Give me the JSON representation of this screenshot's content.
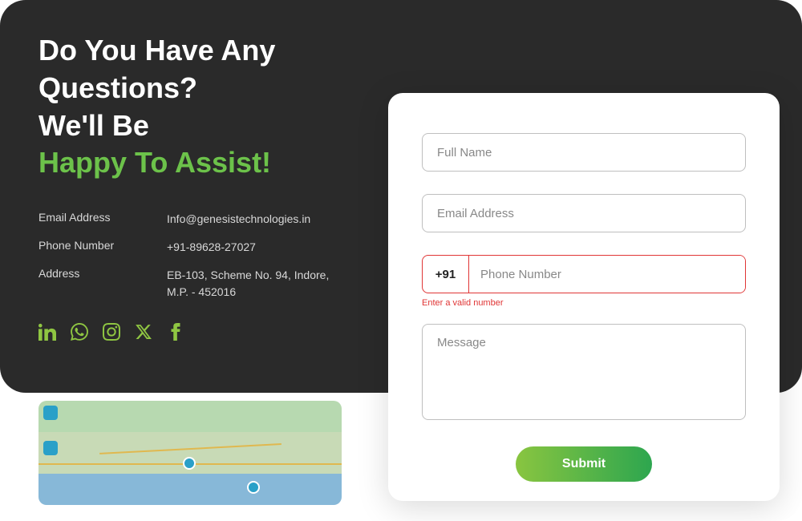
{
  "heading": {
    "line1": "Do You Have Any Questions?",
    "line2": "We'll Be",
    "line3": "Happy To Assist!"
  },
  "contact": {
    "email_label": "Email Address",
    "email_value": "Info@genesistechnologies.in",
    "phone_label": "Phone Number",
    "phone_value": "+91-89628-27027",
    "address_label": "Address",
    "address_value": "EB-103, Scheme No. 94, Indore, M.P. - 452016"
  },
  "form": {
    "fullname_placeholder": "Full Name",
    "email_placeholder": "Email Address",
    "phone_prefix": "+91",
    "phone_placeholder": "Phone Number",
    "phone_error": "Enter a valid number",
    "message_placeholder": "Message",
    "submit_label": "Submit"
  }
}
